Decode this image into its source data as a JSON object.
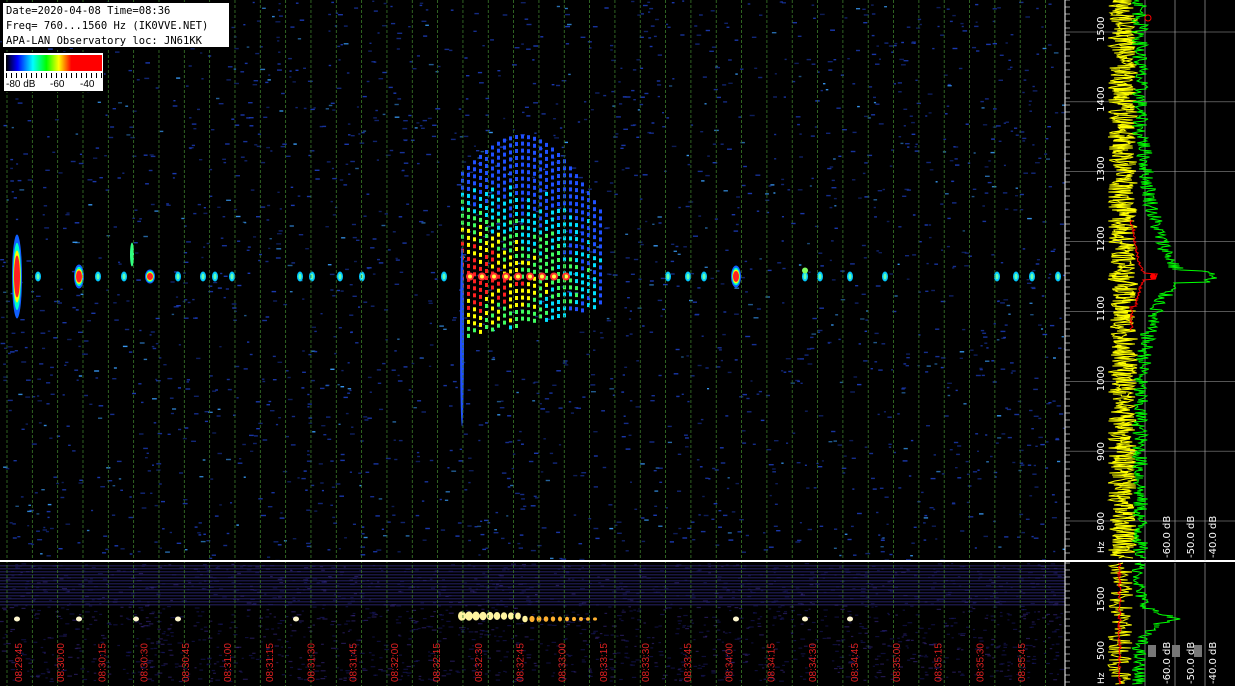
{
  "info": {
    "line1": "Date=2020-04-08 Time=08:36",
    "line2": "Freq= 760...1560 Hz (IK0VVE.NET)",
    "line3": "APA-LAN Observatory loc: JN61KK"
  },
  "legend": {
    "labels": [
      "-80 dB",
      "-60",
      "-40"
    ]
  },
  "freq_axis": {
    "unit": "Hz",
    "ticks": [
      "1500",
      "1400",
      "1300",
      "1200",
      "1100",
      "1000",
      "900",
      "800"
    ]
  },
  "lower_freq_axis": {
    "unit": "Hz",
    "ticks": [
      "1500",
      "500"
    ]
  },
  "db_axis": {
    "ticks": [
      "-60.0 dB",
      "-50.0 dB",
      "-40.0 dB"
    ]
  },
  "time_axis": {
    "ticks": [
      "08:29:45",
      "08:30:00",
      "08:30:15",
      "08:30:30",
      "08:30:45",
      "08:31:00",
      "08:31:15",
      "08:31:30",
      "08:31:45",
      "08:32:00",
      "08:32:15",
      "08:32:30",
      "08:32:45",
      "08:33:00",
      "08:33:15",
      "08:33:30",
      "08:33:45",
      "08:34:00",
      "08:34:15",
      "08:34:30",
      "08:34:45",
      "08:35:00",
      "08:35:15",
      "08:35:30",
      "08:35:45"
    ]
  },
  "colors": {
    "background": "#000000",
    "grid": "#3a7a2a",
    "time_label": "#e02020",
    "spectrum_avg": "#ffff00",
    "spectrum_peak": "#00ff00",
    "spectrum_current": "#ff0000"
  }
}
